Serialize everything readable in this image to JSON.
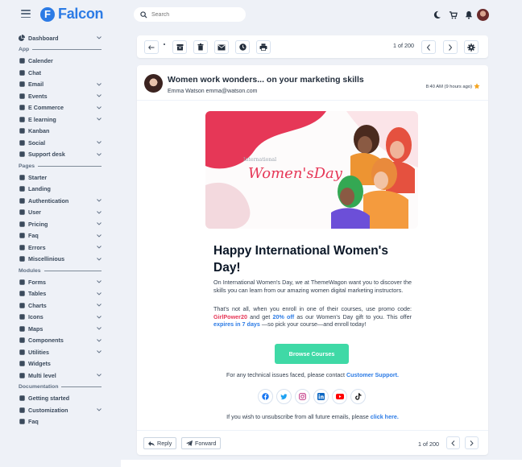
{
  "app": {
    "name": "Falcon"
  },
  "search": {
    "placeholder": "Search"
  },
  "sidebar": {
    "top": [
      {
        "label": "Dashboard"
      }
    ],
    "sections": [
      {
        "title": "App",
        "items": [
          {
            "label": "Calender"
          },
          {
            "label": "Chat"
          },
          {
            "label": "Email"
          },
          {
            "label": "Events"
          },
          {
            "label": "E Commerce"
          },
          {
            "label": "E learning"
          },
          {
            "label": "Kanban"
          },
          {
            "label": "Social"
          },
          {
            "label": "Support desk"
          }
        ]
      },
      {
        "title": "Pages",
        "items": [
          {
            "label": "Starter"
          },
          {
            "label": "Landing"
          },
          {
            "label": "Authentication"
          },
          {
            "label": "User"
          },
          {
            "label": "Pricing"
          },
          {
            "label": "Faq"
          },
          {
            "label": "Errors"
          },
          {
            "label": "Miscellinious"
          }
        ]
      },
      {
        "title": "Modules",
        "items": [
          {
            "label": "Forms"
          },
          {
            "label": "Tables"
          },
          {
            "label": "Charts"
          },
          {
            "label": "Icons"
          },
          {
            "label": "Maps"
          },
          {
            "label": "Components"
          },
          {
            "label": "Utilities"
          },
          {
            "label": "Widgets"
          },
          {
            "label": "Multi level"
          }
        ]
      },
      {
        "title": "Documentation",
        "items": [
          {
            "label": "Getting started"
          },
          {
            "label": "Customization"
          },
          {
            "label": "Faq"
          }
        ]
      }
    ]
  },
  "toolbar": {
    "count": "1 of 200"
  },
  "email": {
    "subject": "Women work wonders... on your marketing skills",
    "from": "Emma Watson emma@watson.com",
    "time": "8:40 AM (9 hours ago)",
    "banner": {
      "small": "International",
      "big": "Women'sDay"
    },
    "heading": "Happy International Women's Day!",
    "para1": "On International Women's Day, we at ThemeWagon want you to discover the skills you can learn from our amazing women digital marketing instructors.",
    "para2": {
      "a": "That's not all, when you enroll in one of their courses, use promo code: ",
      "code": "GirlPower20",
      "b": " and get ",
      "pct": "20% off",
      "c": " as our Women's Day gift to you. This offer ",
      "expires": "expires in 7 days",
      "d": " —so pick your course—and enroll today!"
    },
    "cta": "Browse Courses",
    "support": {
      "text": "For any technical issues faced, please contact ",
      "link": "Customer Support."
    },
    "unsub": {
      "text": "If you wish to unsubscribe from all future emails, please ",
      "link": "click here."
    },
    "reply": "Reply",
    "forward": "Forward",
    "count": "1 of 200"
  },
  "colors": {
    "primary": "#2c7be5",
    "accent": "#e63757",
    "cta": "#3fd9a6"
  }
}
